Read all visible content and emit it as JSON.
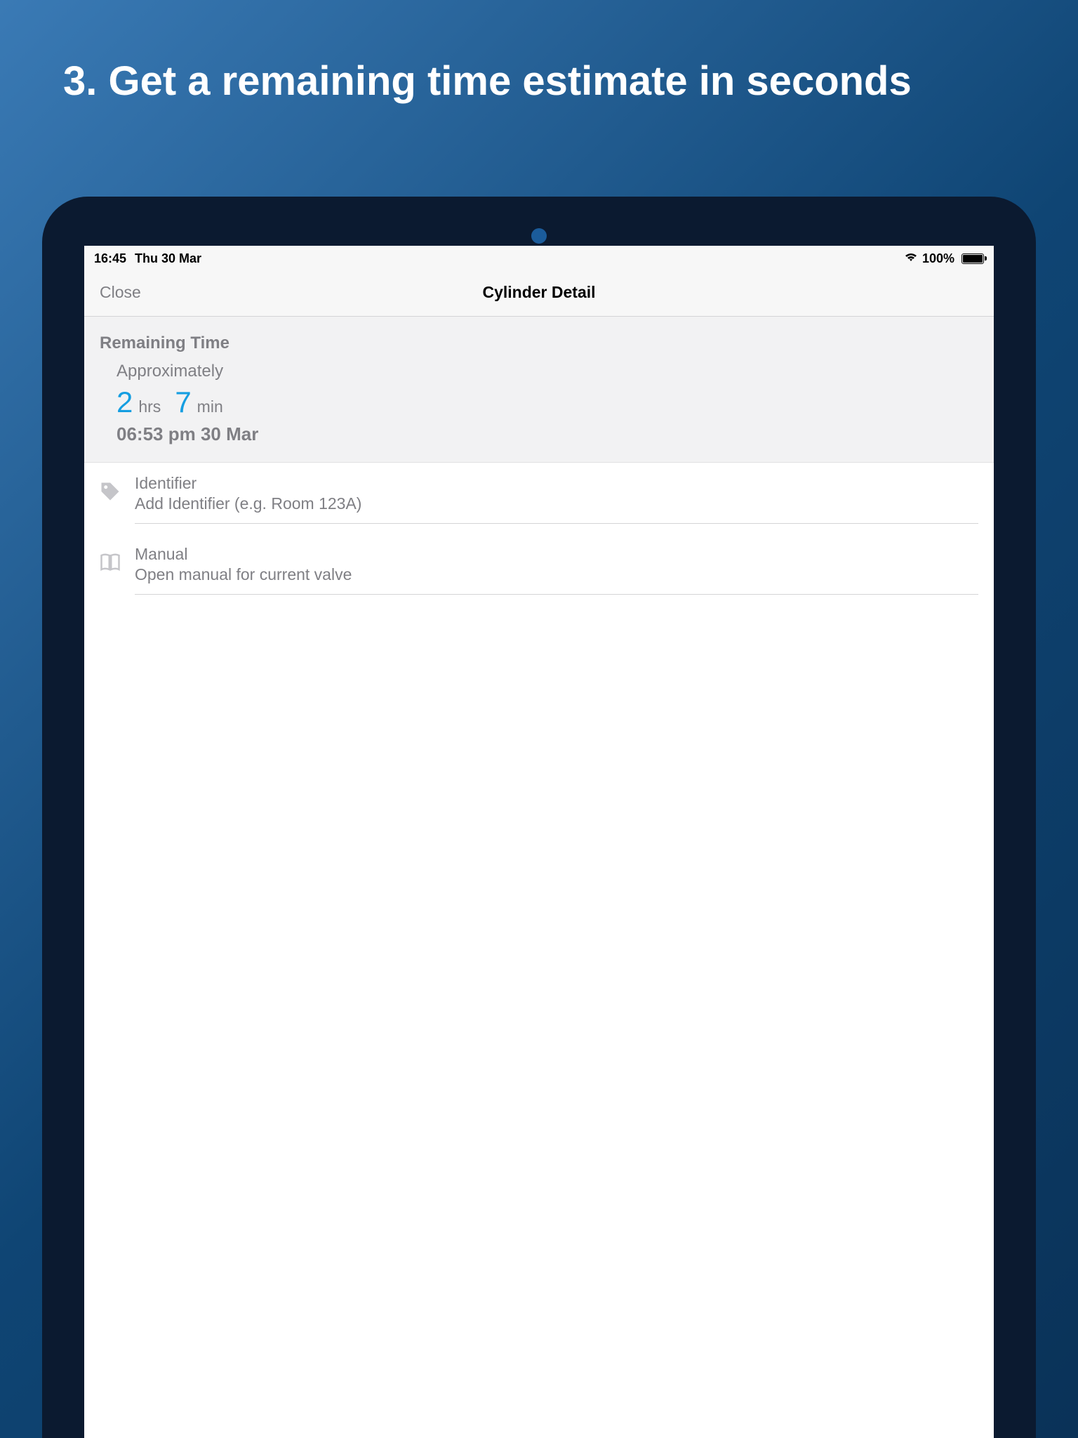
{
  "promo": {
    "heading": "3. Get a remaining time estimate in seconds"
  },
  "statusBar": {
    "time": "16:45",
    "date": "Thu 30 Mar",
    "batteryPercent": "100%"
  },
  "navBar": {
    "closeLabel": "Close",
    "title": "Cylinder Detail"
  },
  "remainingTime": {
    "sectionTitle": "Remaining Time",
    "approxLabel": "Approximately",
    "hoursValue": "2",
    "hoursUnit": "hrs",
    "minutesValue": "7",
    "minutesUnit": "min",
    "endTime": "06:53 pm 30 Mar"
  },
  "items": {
    "identifier": {
      "title": "Identifier",
      "subtitle": "Add Identifier (e.g. Room 123A)"
    },
    "manual": {
      "title": "Manual",
      "subtitle": "Open manual for current valve"
    }
  }
}
